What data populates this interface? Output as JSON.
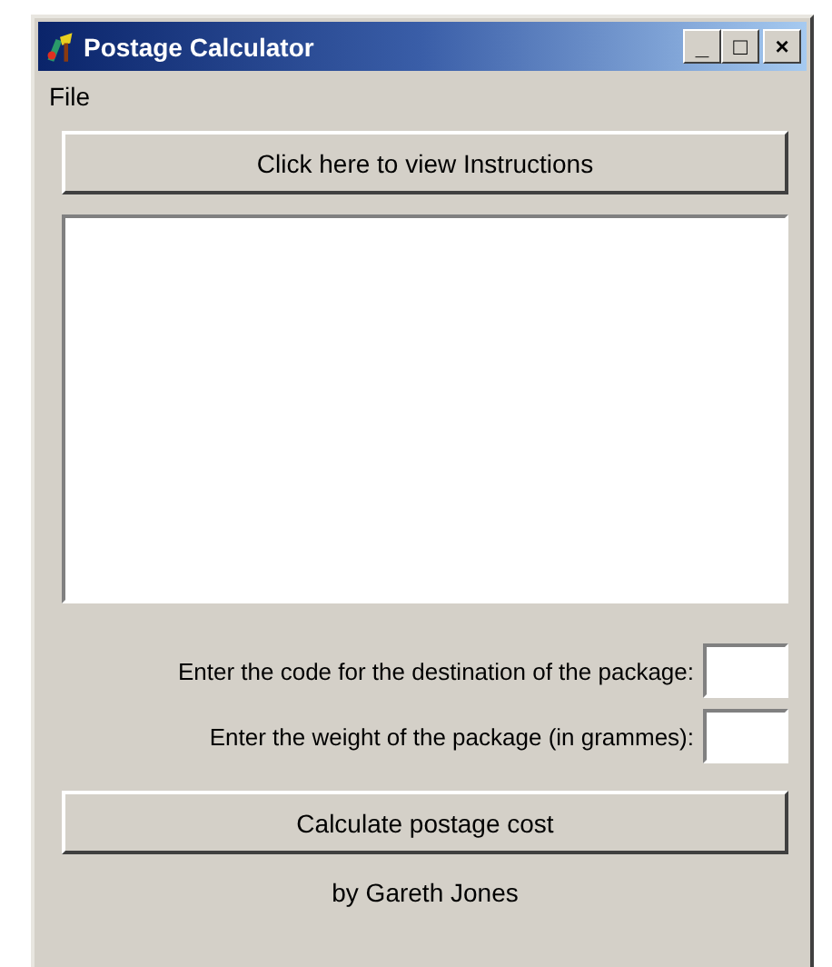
{
  "window": {
    "title": "Postage Calculator",
    "controls": [
      "_",
      "□",
      "×"
    ]
  },
  "menu": [
    {
      "label": "File"
    }
  ],
  "instructions_button": "Click here to view Instructions",
  "fields": [
    {
      "label": "Enter the code for the destination of the package:"
    },
    {
      "label": "Enter the weight of the package (in grammes):"
    }
  ],
  "calculate_button": "Calculate postage cost",
  "credit": "by Gareth Jones"
}
